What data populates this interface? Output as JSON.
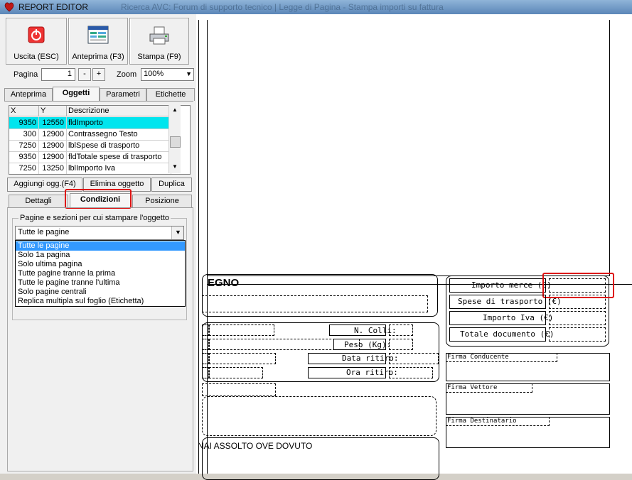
{
  "window": {
    "title": "REPORT EDITOR",
    "background_title": "Ricerca AVC: Forum di supporto tecnico | Legge di Pagina - Stampa importi su fattura"
  },
  "toolbar": {
    "exit_label": "Uscita (ESC)",
    "preview_label": "Anteprima (F3)",
    "print_label": "Stampa (F9)"
  },
  "paging": {
    "page_label": "Pagina",
    "page_value": "1",
    "minus": "-",
    "plus": "+",
    "zoom_label": "Zoom",
    "zoom_value": "100%"
  },
  "top_tabs": [
    "Anteprima",
    "Oggetti",
    "Parametri",
    "Etichette"
  ],
  "top_tabs_active": "Oggetti",
  "grid": {
    "columns": [
      "X",
      "Y",
      "Descrizione"
    ],
    "rows": [
      {
        "x": "9350",
        "y": "12550",
        "desc": "fldImporto",
        "selected": true
      },
      {
        "x": "300",
        "y": "12900",
        "desc": "Contrassegno Testo",
        "selected": false
      },
      {
        "x": "7250",
        "y": "12900",
        "desc": "lblSpese di trasporto",
        "selected": false
      },
      {
        "x": "9350",
        "y": "12900",
        "desc": "fldTotale spese di trasporto",
        "selected": false
      },
      {
        "x": "7250",
        "y": "13250",
        "desc": "lblImporto Iva",
        "selected": false
      }
    ]
  },
  "object_buttons": {
    "add": "Aggiungi ogg.(F4)",
    "delete": "Elimina oggetto",
    "duplicate": "Duplica"
  },
  "sub_tabs": [
    "Dettagli",
    "Condizioni",
    "Posizione"
  ],
  "sub_tabs_active": "Condizioni",
  "conditions": {
    "group_label": "Pagine e sezioni per cui stampare l'oggetto",
    "selected": "Tutte le pagine",
    "options": [
      "Tutte le pagine",
      "Solo 1a pagina",
      "Solo ultima pagina",
      "Tutte pagine tranne la prima",
      "Tutte le pagine tranne l'ultima",
      "Solo pagine centrali",
      "Replica multipla sul foglio (Etichetta)"
    ]
  },
  "report": {
    "contrassegno_fragment": "EGNO",
    "importo_merce": "Importo merce (€)",
    "spese_trasporto": "Spese di trasporto (€)",
    "importo_iva": "Importo Iva (€)",
    "totale_documento": "Totale documento (€)",
    "n_colli": "N. Colli:",
    "peso": "Peso (Kg):",
    "data_ritiro": "Data ritiro:",
    "ora_ritiro": "Ora ritiro:",
    "firma_conducente": "Firma Conducente",
    "firma_vettore": "Firma Vettore",
    "firma_destinatario": "Firma Destinatario",
    "footer_text": "NAI ASSOLTO OVE DOVUTO"
  },
  "colors": {
    "selection_row": "#00e5ee",
    "list_highlight": "#3399ff",
    "annotation": "#dd1111"
  }
}
